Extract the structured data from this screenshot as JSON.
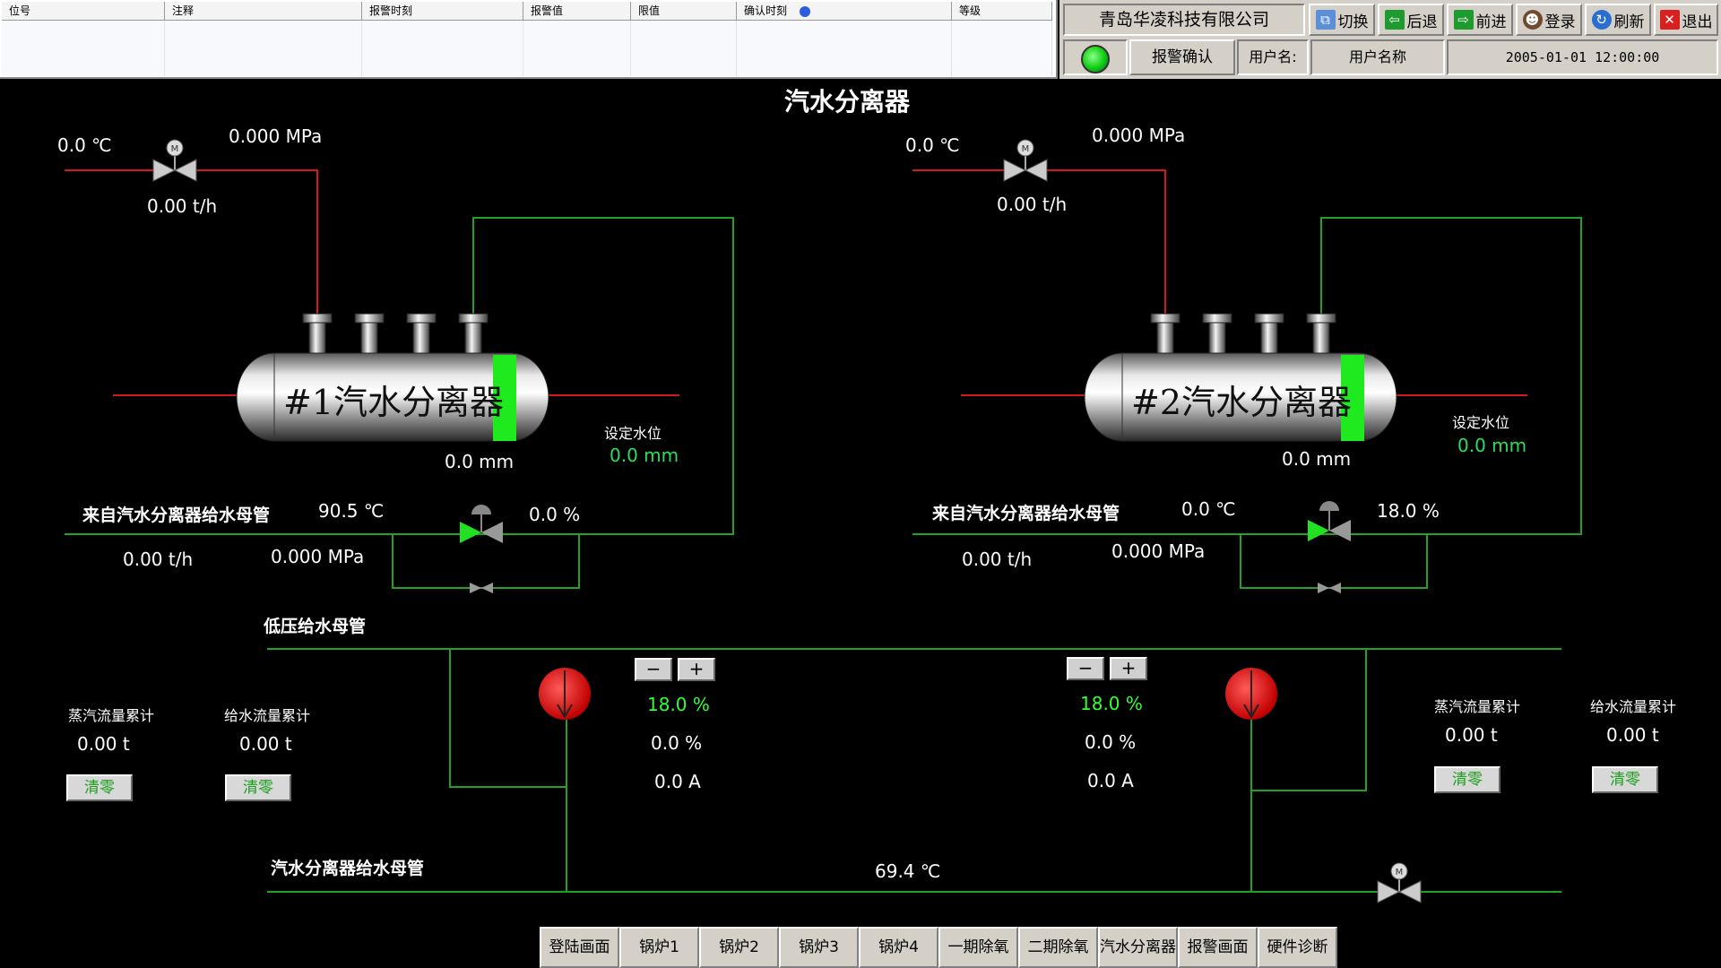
{
  "alarm_table": {
    "columns": [
      "位号",
      "注释",
      "报警时刻",
      "报警值",
      "限值",
      "确认时刻",
      "等级"
    ]
  },
  "top_panel": {
    "company": "青岛华凌科技有限公司",
    "buttons": {
      "switch": "切换",
      "back": "后退",
      "forward": "前进",
      "login": "登录",
      "refresh": "刷新",
      "exit": "退出"
    },
    "alarm_confirm": "报警确认",
    "user_label": "用户名:",
    "user_name": "用户名称",
    "datetime": "2005-01-01 12:00:00"
  },
  "page_title": "汽水分离器",
  "separator1": {
    "name": "#1汽水分离器",
    "steam_temp": "0.0 ℃",
    "steam_pressure": "0.000 MPa",
    "steam_flow": "0.00 t/h",
    "level": "0.0 mm",
    "setpoint_label": "设定水位",
    "setpoint": "0.0 mm",
    "feed_label": "来自汽水分离器给水母管",
    "feed_temp": "90.5 ℃",
    "valve_open": "0.0 %",
    "feed_flow": "0.00 t/h",
    "feed_pressure": "0.000 MPa"
  },
  "separator2": {
    "name": "#2汽水分离器",
    "steam_temp": "0.0 ℃",
    "steam_pressure": "0.000 MPa",
    "steam_flow": "0.00 t/h",
    "level": "0.0 mm",
    "setpoint_label": "设定水位",
    "setpoint": "0.0 mm",
    "feed_label": "来自汽水分离器给水母管",
    "feed_temp": "0.0 ℃",
    "valve_open": "18.0 %",
    "feed_flow": "0.00 t/h",
    "feed_pressure": "0.000 MPa"
  },
  "low_pressure_header": "低压给水母管",
  "separator_feed_header": "汽水分离器给水母管",
  "header_temp": "69.4 ℃",
  "pump1": {
    "minus": "−",
    "plus": "+",
    "setpoint": "18.0 %",
    "feedback": "0.0 %",
    "current": "0.0 A"
  },
  "pump2": {
    "minus": "−",
    "plus": "+",
    "setpoint": "18.0 %",
    "feedback": "0.0 %",
    "current": "0.0 A"
  },
  "totals_left": {
    "steam_label": "蒸汽流量累计",
    "steam_value": "0.00 t",
    "water_label": "给水流量累计",
    "water_value": "0.00 t",
    "clear": "清零"
  },
  "totals_right": {
    "steam_label": "蒸汽流量累计",
    "steam_value": "0.00 t",
    "water_label": "给水流量累计",
    "water_value": "0.00 t",
    "clear": "清零"
  },
  "nav_tabs": [
    "登陆画面",
    "锅炉1",
    "锅炉2",
    "锅炉3",
    "锅炉4",
    "一期除氧",
    "二期除氧",
    "汽水分离器",
    "报警画面",
    "硬件诊断"
  ],
  "colors": {
    "steam_line": "#d11a1a",
    "water_line": "#21a321",
    "level_bar": "#1eea1e",
    "pump": "#ee1111"
  }
}
